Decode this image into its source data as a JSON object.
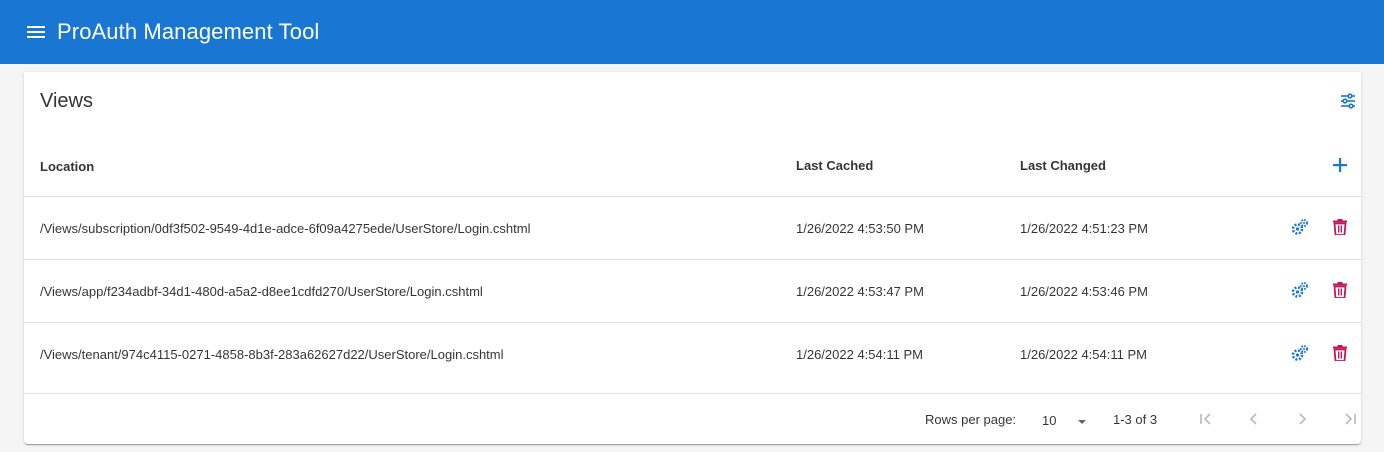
{
  "app": {
    "title": "ProAuth Management Tool",
    "menu_icon": "menu-icon"
  },
  "card": {
    "title": "Views",
    "filter_icon": "tune-icon"
  },
  "table": {
    "columns": {
      "location": "Location",
      "last_cached": "Last Cached",
      "last_changed": "Last Changed"
    },
    "add_icon": "plus-icon",
    "rows": [
      {
        "location": "/Views/subscription/0df3f502-9549-4d1e-adce-6f09a4275ede/UserStore/Login.cshtml",
        "last_cached": "1/26/2022 4:53:50 PM",
        "last_changed": "1/26/2022 4:51:23 PM"
      },
      {
        "location": "/Views/app/f234adbf-34d1-480d-a5a2-d8ee1cdfd270/UserStore/Login.cshtml",
        "last_cached": "1/26/2022 4:53:47 PM",
        "last_changed": "1/26/2022 4:53:46 PM"
      },
      {
        "location": "/Views/tenant/974c4115-0271-4858-8b3f-283a62627d22/UserStore/Login.cshtml",
        "last_cached": "1/26/2022 4:54:11 PM",
        "last_changed": "1/26/2022 4:54:11 PM"
      }
    ]
  },
  "pagination": {
    "rows_per_page_label": "Rows per page:",
    "rows_per_page": "10",
    "range": "1-3 of 3"
  },
  "colors": {
    "primary": "#1976d2",
    "delete": "#c2185b",
    "divider": "#e0e0e0"
  }
}
